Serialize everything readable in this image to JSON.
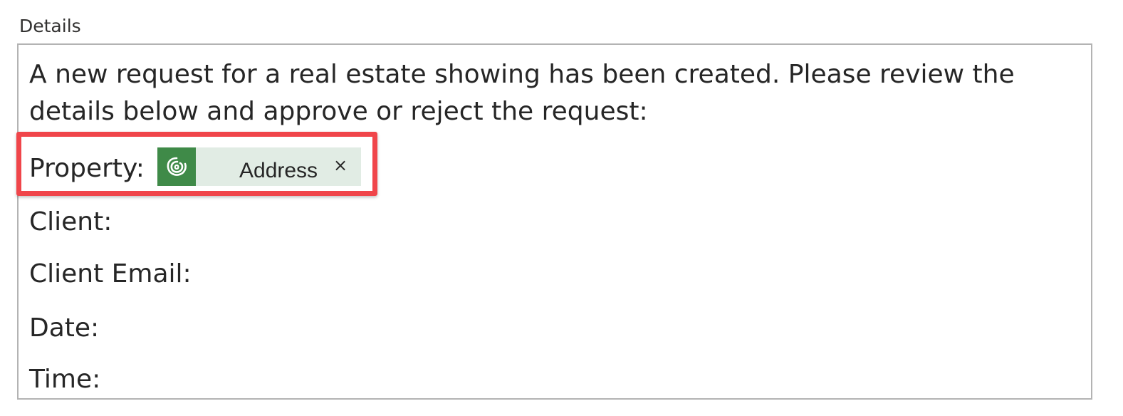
{
  "field": {
    "label": "Details"
  },
  "editor": {
    "intro": "A new request for a real estate showing has been created. Please review the details below and approve or reject the request:",
    "lines": {
      "property": "Property:",
      "client": "Client:",
      "client_email": "Client Email:",
      "date": "Date:",
      "time": "Time:"
    },
    "token": {
      "label": "Address",
      "remove": "×",
      "icon": "dataverse-icon",
      "color": "#3f8a48",
      "background": "#e1ece4"
    }
  },
  "annotation": {
    "color": "#f0454a"
  }
}
